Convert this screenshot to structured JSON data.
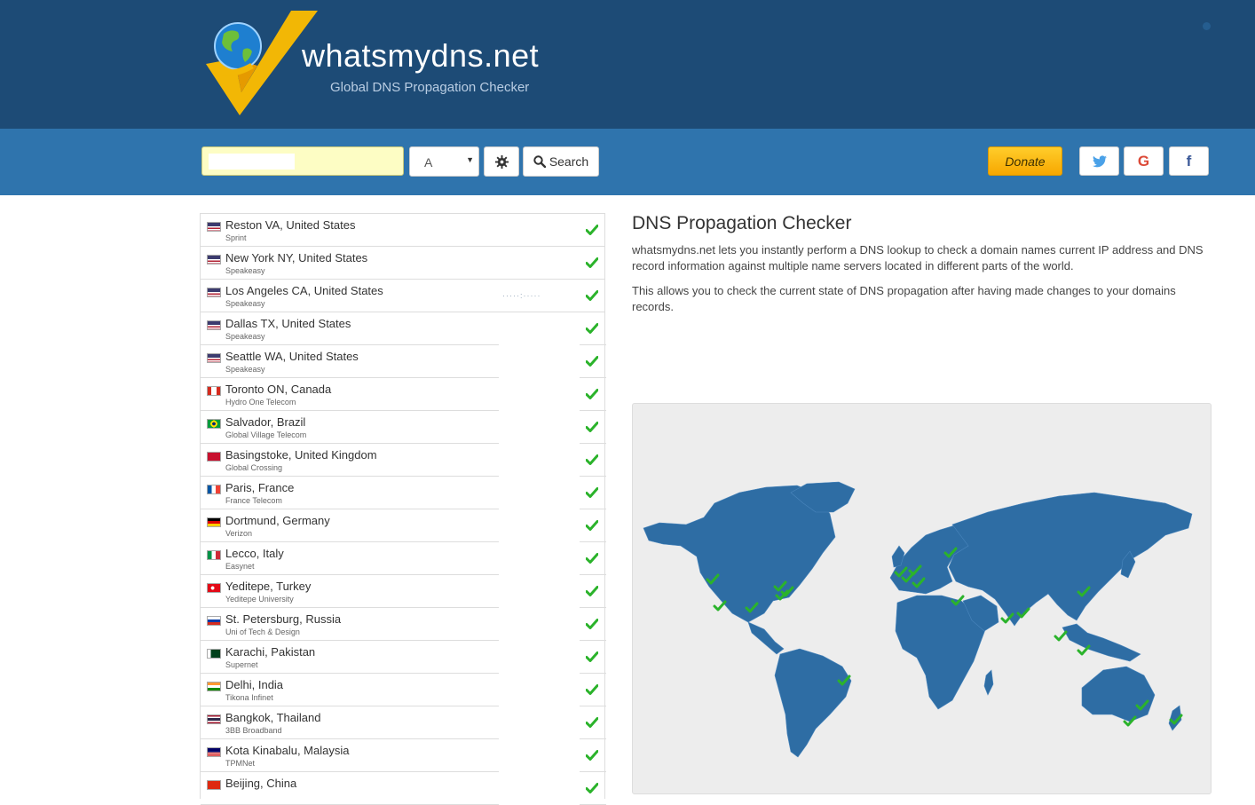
{
  "header": {
    "logo_text": "whatsmydns.net",
    "tagline": "Global DNS Propagation Checker"
  },
  "search": {
    "domain_value": "",
    "domain_placeholder": "",
    "record_type": "A",
    "settings_icon": "gear-icon",
    "search_icon": "search-icon",
    "search_label": "Search",
    "donate_label": "Donate",
    "social": [
      {
        "name": "twitter",
        "glyph": "🐦",
        "icon": "twitter-icon"
      },
      {
        "name": "google",
        "glyph": "G",
        "icon": "google-icon"
      },
      {
        "name": "facebook",
        "glyph": "f",
        "icon": "facebook-icon"
      }
    ]
  },
  "colors": {
    "header_bg": "#1d4b76",
    "searchbar_bg": "#2f74ad",
    "check_green": "#2bb32b",
    "map_land": "#2e6da4",
    "donate": "#f7b500"
  },
  "results": [
    {
      "location": "Reston VA, United States",
      "provider": "Sprint",
      "flag": "us",
      "ip": "",
      "status": "ok"
    },
    {
      "location": "New York NY, United States",
      "provider": "Speakeasy",
      "flag": "us",
      "ip": "",
      "status": "ok"
    },
    {
      "location": "Los Angeles CA, United States",
      "provider": "Speakeasy",
      "flag": "us",
      "ip": "·····:·····",
      "status": "ok"
    },
    {
      "location": "Dallas TX, United States",
      "provider": "Speakeasy",
      "flag": "us",
      "ip": "",
      "status": "ok"
    },
    {
      "location": "Seattle WA, United States",
      "provider": "Speakeasy",
      "flag": "us",
      "ip": "",
      "status": "ok"
    },
    {
      "location": "Toronto ON, Canada",
      "provider": "Hydro One Telecom",
      "flag": "ca",
      "ip": "",
      "status": "ok"
    },
    {
      "location": "Salvador, Brazil",
      "provider": "Global Village Telecom",
      "flag": "br",
      "ip": "",
      "status": "ok"
    },
    {
      "location": "Basingstoke, United Kingdom",
      "provider": "Global Crossing",
      "flag": "gb",
      "ip": "",
      "status": "ok"
    },
    {
      "location": "Paris, France",
      "provider": "France Telecom",
      "flag": "fr",
      "ip": "",
      "status": "ok"
    },
    {
      "location": "Dortmund, Germany",
      "provider": "Verizon",
      "flag": "de",
      "ip": "",
      "status": "ok"
    },
    {
      "location": "Lecco, Italy",
      "provider": "Easynet",
      "flag": "it",
      "ip": "",
      "status": "ok"
    },
    {
      "location": "Yeditepe, Turkey",
      "provider": "Yeditepe University",
      "flag": "tr",
      "ip": "",
      "status": "ok"
    },
    {
      "location": "St. Petersburg, Russia",
      "provider": "Uni of Tech & Design",
      "flag": "ru",
      "ip": "",
      "status": "ok"
    },
    {
      "location": "Karachi, Pakistan",
      "provider": "Supernet",
      "flag": "pk",
      "ip": "",
      "status": "ok"
    },
    {
      "location": "Delhi, India",
      "provider": "Tikona Infinet",
      "flag": "in",
      "ip": "",
      "status": "ok"
    },
    {
      "location": "Bangkok, Thailand",
      "provider": "3BB Broadband",
      "flag": "th",
      "ip": "",
      "status": "ok"
    },
    {
      "location": "Kota Kinabalu, Malaysia",
      "provider": "TPMNet",
      "flag": "my",
      "ip": "",
      "status": "ok"
    },
    {
      "location": "Beijing, China",
      "provider": "",
      "flag": "cn",
      "ip": "",
      "status": "ok"
    }
  ],
  "info": {
    "title": "DNS Propagation Checker",
    "paragraph1": "whatsmydns.net lets you instantly perform a DNS lookup to check a domain names current IP address and DNS record information against multiple name servers located in different parts of the world.",
    "paragraph2": "This allows you to check the current state of DNS propagation after having made changes to your domains records."
  },
  "map": {
    "markers": [
      {
        "city": "Seattle",
        "status": "ok"
      },
      {
        "city": "Los Angeles",
        "status": "ok"
      },
      {
        "city": "Dallas",
        "status": "ok"
      },
      {
        "city": "Toronto",
        "status": "ok"
      },
      {
        "city": "New York",
        "status": "ok"
      },
      {
        "city": "Reston",
        "status": "ok"
      },
      {
        "city": "Salvador",
        "status": "ok"
      },
      {
        "city": "Basingstoke",
        "status": "ok"
      },
      {
        "city": "Paris",
        "status": "ok"
      },
      {
        "city": "Dortmund",
        "status": "ok"
      },
      {
        "city": "Lecco",
        "status": "ok"
      },
      {
        "city": "St. Petersburg",
        "status": "ok"
      },
      {
        "city": "Yeditepe",
        "status": "ok"
      },
      {
        "city": "Karachi",
        "status": "ok"
      },
      {
        "city": "Delhi",
        "status": "ok"
      },
      {
        "city": "Beijing",
        "status": "ok"
      },
      {
        "city": "Bangkok",
        "status": "ok"
      },
      {
        "city": "Kota Kinabalu",
        "status": "ok"
      },
      {
        "city": "Sydney",
        "status": "ok"
      },
      {
        "city": "Melbourne",
        "status": "ok"
      },
      {
        "city": "Auckland",
        "status": "ok"
      }
    ]
  }
}
